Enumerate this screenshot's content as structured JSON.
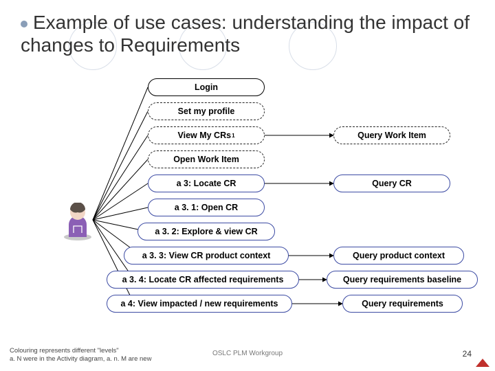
{
  "title": "Example of use cases: understanding the impact of changes to Requirements",
  "useCases": {
    "login": {
      "label": "Login"
    },
    "setProfile": {
      "label": "Set my profile"
    },
    "viewMyCRs": {
      "label": "View My CRs"
    },
    "viewMyCRsSup": {
      "sup": "1"
    },
    "openWorkItem": {
      "label": "Open Work Item"
    },
    "a3LocateCR": {
      "label": "a 3: Locate CR"
    },
    "a31OpenCR": {
      "label": "a 3. 1: Open CR"
    },
    "a32Explore": {
      "label": "a 3. 2: Explore & view CR"
    },
    "a33ProdCtx": {
      "label": "a 3. 3: View CR product context"
    },
    "a34AffectedReq": {
      "label": "a 3. 4: Locate CR affected requirements"
    },
    "a4ViewImpacted": {
      "label": "a 4: View impacted / new requirements"
    },
    "queryWorkItem": {
      "label": "Query Work Item"
    },
    "queryCR": {
      "label": "Query CR"
    },
    "queryProdCtx": {
      "label": "Query product context"
    },
    "queryReqBaseline": {
      "label": "Query requirements baseline"
    },
    "queryReq": {
      "label": "Query requirements"
    }
  },
  "footer": {
    "legendLine1": "Colouring represents different \"levels\"",
    "legendLine2": "a. N were in the Activity diagram, a. n. M are new",
    "center": "OSLC PLM Workgroup",
    "page": "24"
  }
}
